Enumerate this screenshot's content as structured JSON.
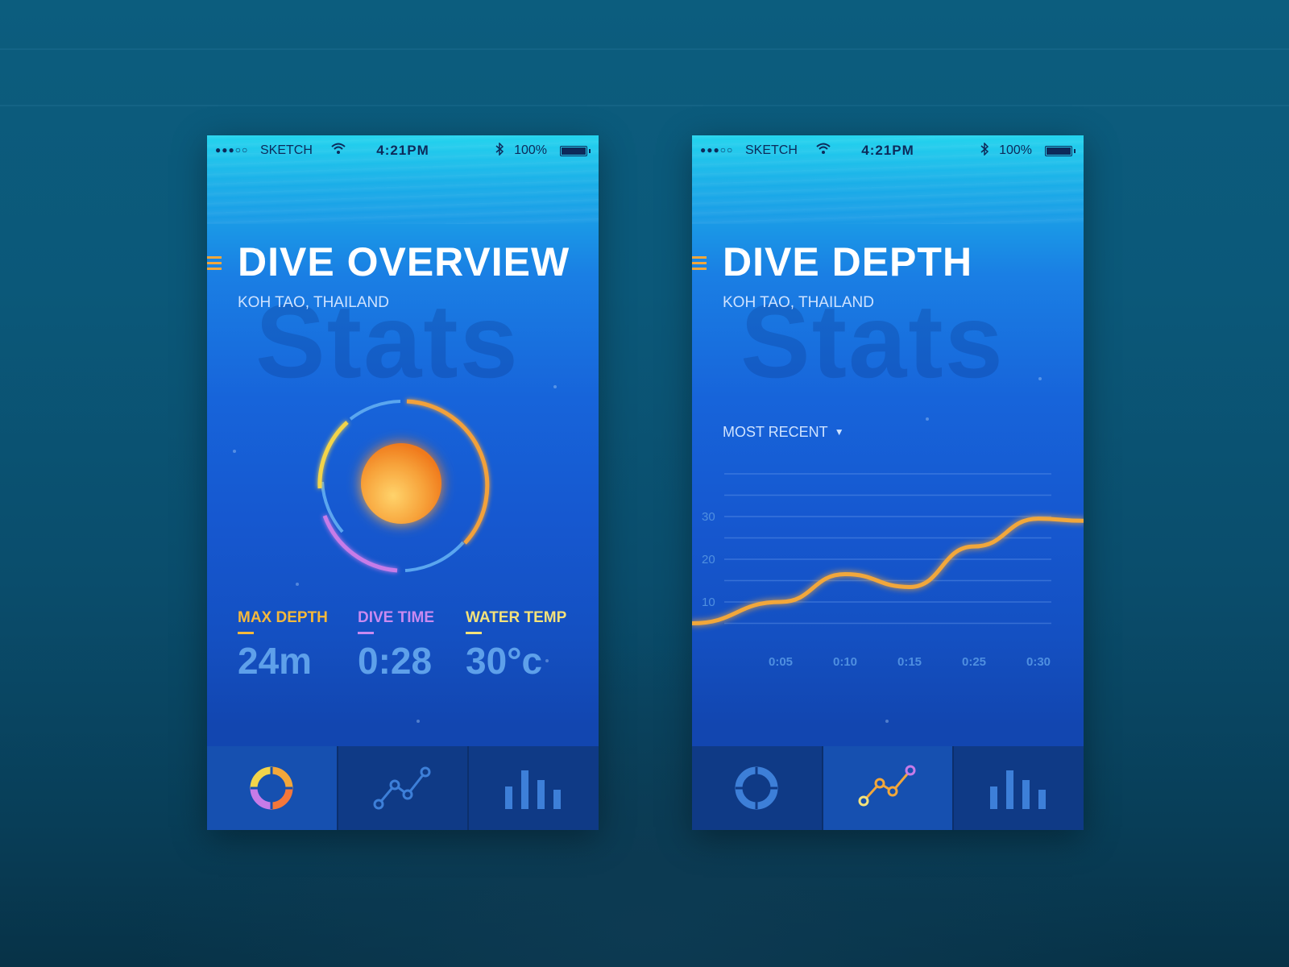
{
  "status_bar": {
    "signal_dots": "●●●○○",
    "carrier": "SKETCH",
    "time": "4:21PM",
    "battery": "100%"
  },
  "overview": {
    "title": "DIVE OVERVIEW",
    "location": "KOH TAO, THAILAND",
    "watermark": "Stats",
    "stats": [
      {
        "label": "MAX DEPTH",
        "value": "24m",
        "color": "#f6b93b"
      },
      {
        "label": "DIVE TIME",
        "value": "0:28",
        "color": "#c98af0"
      },
      {
        "label": "WATER TEMP",
        "value": "30°c",
        "color": "#f4e27a"
      }
    ]
  },
  "depth": {
    "title": "DIVE DEPTH",
    "location": "KOH TAO, THAILAND",
    "watermark": "Stats",
    "filter": "MOST RECENT",
    "chart_data": {
      "type": "line",
      "title": "",
      "xlabel": "",
      "ylabel": "",
      "categories": [
        "0:05",
        "0:10",
        "0:15",
        "0:25",
        "0:30"
      ],
      "y_ticks": [
        10,
        20,
        30
      ],
      "ylim": [
        0,
        40
      ],
      "series": [
        {
          "values": [
            10,
            16.5,
            13.5,
            23,
            29.5
          ]
        }
      ],
      "grid": true,
      "line_color": "#f2a73a"
    }
  },
  "tabs": {
    "icons": [
      "donut-chart-icon",
      "line-chart-icon",
      "bar-chart-icon"
    ]
  }
}
